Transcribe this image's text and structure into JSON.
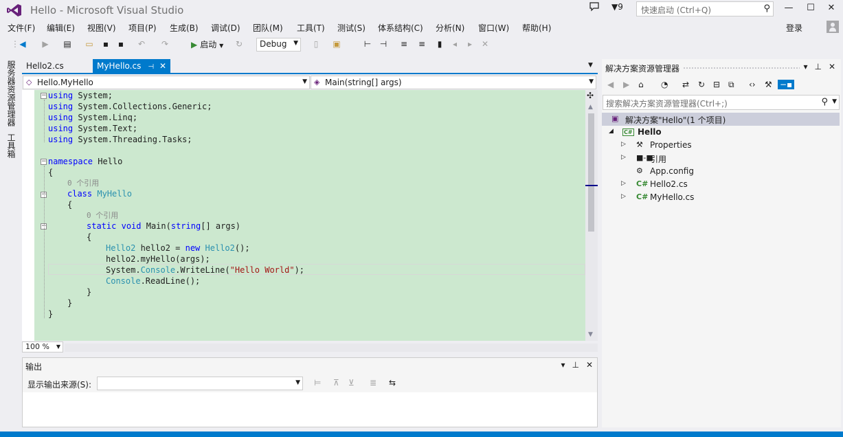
{
  "window": {
    "title": "Hello - Microsoft Visual Studio",
    "notification_count": "9",
    "quick_launch_placeholder": "快速启动 (Ctrl+Q)",
    "login_label": "登录"
  },
  "menu": [
    "文件(F)",
    "编辑(E)",
    "视图(V)",
    "项目(P)",
    "生成(B)",
    "调试(D)",
    "团队(M)",
    "工具(T)",
    "测试(S)",
    "体系结构(C)",
    "分析(N)",
    "窗口(W)",
    "帮助(H)"
  ],
  "toolbar": {
    "start_label": "启动",
    "config_value": "Debug"
  },
  "left_tabs": [
    "服务器资源管理器",
    "工具箱"
  ],
  "doc_tabs": [
    {
      "label": "Hello2.cs",
      "active": false
    },
    {
      "label": "MyHello.cs",
      "active": true
    }
  ],
  "navbar": {
    "type_combo": "Hello.MyHello",
    "member_combo": "Main(string[] args)"
  },
  "code": {
    "lines": [
      "using System;",
      "using System.Collections.Generic;",
      "using System.Linq;",
      "using System.Text;",
      "using System.Threading.Tasks;",
      "",
      "namespace Hello",
      "{",
      "0 个引用",
      "class MyHello",
      "{",
      "0 个引用",
      "static void Main(string[] args)",
      "{",
      "Hello2 hello2 = new Hello2();",
      "hello2.myHello(args);",
      "System.Console.WriteLine(\"Hello World\");",
      "Console.ReadLine();",
      "}",
      "}",
      "}"
    ],
    "background_color": "#cce8cf"
  },
  "zoom": {
    "value": "100 %"
  },
  "output": {
    "title": "输出",
    "source_label": "显示输出来源(S):",
    "source_value": ""
  },
  "solution_explorer": {
    "title": "解决方案资源管理器",
    "search_placeholder": "搜索解决方案资源管理器(Ctrl+;)",
    "tree": [
      {
        "label": "解决方案\"Hello\"(1 个项目)",
        "level": 0,
        "icon": "solution-icon",
        "expander": "",
        "selected": true
      },
      {
        "label": "Hello",
        "level": 1,
        "icon": "csharp-project-icon",
        "expander": "expanded",
        "bold": true
      },
      {
        "label": "Properties",
        "level": 2,
        "icon": "wrench-icon",
        "expander": "collapsed"
      },
      {
        "label": "引用",
        "level": 2,
        "icon": "references-icon",
        "expander": "collapsed"
      },
      {
        "label": "App.config",
        "level": 2,
        "icon": "config-icon",
        "expander": ""
      },
      {
        "label": "Hello2.cs",
        "level": 2,
        "icon": "csharp-file-icon",
        "expander": "collapsed"
      },
      {
        "label": "MyHello.cs",
        "level": 2,
        "icon": "csharp-file-icon",
        "expander": "collapsed"
      }
    ]
  },
  "colors": {
    "accent": "#007acc",
    "chrome": "#eeeef2",
    "keyword": "#0000ff",
    "type": "#2b91af",
    "string": "#a31515"
  }
}
